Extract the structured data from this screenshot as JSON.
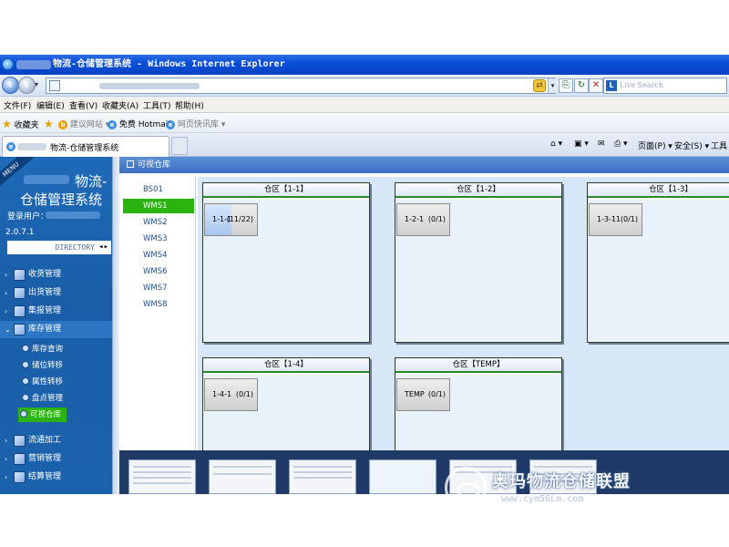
{
  "browser": {
    "window_title": "物流-仓储管理系统 - Windows Internet Explorer",
    "search_placeholder": "Live Search",
    "menu": [
      "文件(F)",
      "编辑(E)",
      "查看(V)",
      "收藏夹(A)",
      "工具(T)",
      "帮助(H)"
    ],
    "favorites": {
      "label": "收藏夹",
      "items": [
        "建议网站 ▾",
        "免费 Hotmail",
        "网页快讯库 ▾"
      ]
    },
    "tab_title": "物流-仓储管理系统",
    "command_bar": {
      "page": "页面(P) ▾",
      "safety": "安全(S) ▾",
      "tools": "工具"
    }
  },
  "app": {
    "menu_ribbon": "MENU",
    "brand_line1": "物流-",
    "brand_line2": "仓储管理系统",
    "login_label": "登录用户：",
    "version": "2.0.7.1",
    "directory_label": "DIRECTORY",
    "nav": [
      {
        "label": "收货管理"
      },
      {
        "label": "出货管理"
      },
      {
        "label": "集报管理"
      },
      {
        "label": "库存管理",
        "expanded": true
      }
    ],
    "subnav": [
      {
        "label": "库存查询"
      },
      {
        "label": "储位转移"
      },
      {
        "label": "属性转移"
      },
      {
        "label": "盘点管理"
      },
      {
        "label": "可视仓库",
        "active": true
      }
    ],
    "nav_bottom": [
      {
        "label": "流通加工"
      },
      {
        "label": "营销管理"
      },
      {
        "label": "结算管理"
      }
    ],
    "main_title": "可视仓库",
    "warehouses": [
      "BS01",
      "WMS1",
      "WMS2",
      "WMS3",
      "WMS4",
      "WMS6",
      "WMS7",
      "WMS8"
    ],
    "selected_warehouse": "WMS1",
    "zones": [
      {
        "title": "仓区【1-1】",
        "locations": [
          {
            "code": "1-1-1",
            "qty": "(11/22)",
            "fill": 0.5
          }
        ]
      },
      {
        "title": "仓区【1-2】",
        "locations": [
          {
            "code": "1-2-1",
            "qty": "(0/1)",
            "fill": 0
          }
        ]
      },
      {
        "title": "仓区【1-3】",
        "locations": [
          {
            "code": "1-3-11",
            "qty": "(0/1)",
            "fill": 0
          }
        ]
      },
      {
        "title": "仓区【1-4】",
        "locations": [
          {
            "code": "1-4-1",
            "qty": "(0/1)",
            "fill": 0
          }
        ]
      },
      {
        "title": "仓区【TEMP】",
        "locations": [
          {
            "code": "TEMP",
            "qty": "(0/1)",
            "fill": 0
          }
        ]
      }
    ]
  },
  "watermark": {
    "title": "奥玛物流仓储联盟",
    "url": "www.cym56Lm.com"
  }
}
